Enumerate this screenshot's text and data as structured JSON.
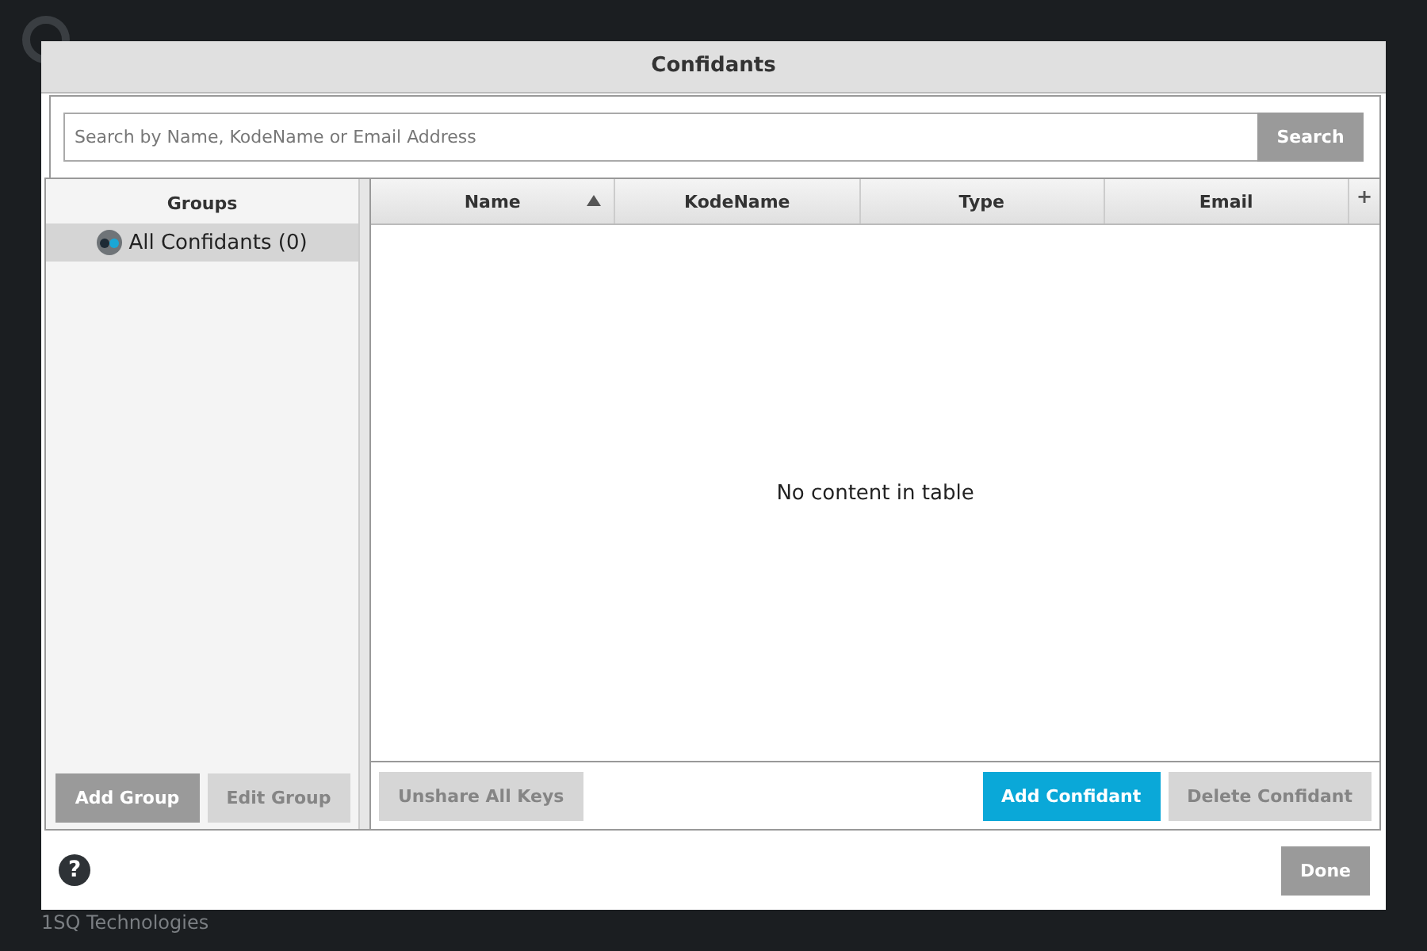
{
  "app": {
    "footer": "1SQ Technologies"
  },
  "dialog": {
    "title": "Confidants"
  },
  "search": {
    "placeholder": "Search by Name, KodeName or Email Address",
    "button": "Search"
  },
  "groups": {
    "heading": "Groups",
    "items": [
      {
        "label": "All Confidants (0)",
        "selected": true
      }
    ],
    "buttons": [
      {
        "label": "Add Group",
        "disabled": false
      },
      {
        "label": "Edit Group",
        "disabled": true
      }
    ]
  },
  "table": {
    "columns": [
      {
        "label": "Name",
        "sorted": true
      },
      {
        "label": "KodeName",
        "sorted": false
      },
      {
        "label": "Type",
        "sorted": false
      },
      {
        "label": "Email",
        "sorted": false
      }
    ],
    "add_column": "+",
    "empty_message": "No content in table",
    "buttons": [
      {
        "label": "Unshare All Keys",
        "kind": "default",
        "disabled": true
      },
      {
        "label": "Add Confidant",
        "kind": "primary",
        "disabled": false
      },
      {
        "label": "Delete Confidant",
        "kind": "default",
        "disabled": true
      }
    ]
  },
  "footer": {
    "help": "?",
    "done": "Done"
  }
}
